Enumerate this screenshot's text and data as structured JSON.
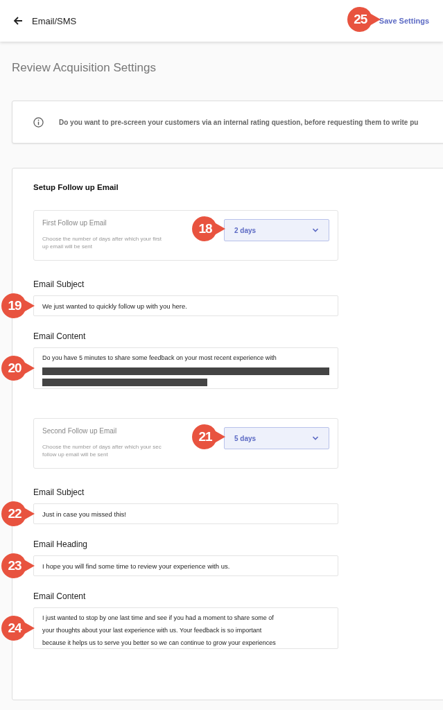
{
  "header": {
    "title": "Email/SMS",
    "save": {
      "label": "Save Settings",
      "callout": "25"
    }
  },
  "page_title": "Review Acquisition Settings",
  "info": {
    "text": "Do you want to pre-screen your customers via an internal rating question, before requesting them to write pu"
  },
  "card": {
    "title": "Setup Follow up Email",
    "items": [
      {
        "kind": "delay",
        "label": "First Follow up Email",
        "description_lines": [
          "Choose the number of days after which your first",
          "up email will be sent"
        ],
        "value": "2 days",
        "callout": "18"
      },
      {
        "kind": "field",
        "label": "Email Subject",
        "value": "We just wanted to quickly follow up with you here.",
        "callout": "19"
      },
      {
        "kind": "textarea",
        "label": "Email Content",
        "lines": [
          "Do you have 5 minutes to share some feedback on your most recent experience with"
        ],
        "redacted": true,
        "callout": "20"
      },
      {
        "kind": "delay",
        "label": "Second Follow up Email",
        "description_lines": [
          "Choose the number of days after which your sec",
          "follow up email will be sent"
        ],
        "value": "5 days",
        "callout": "21"
      },
      {
        "kind": "field",
        "label": "Email Subject",
        "value": "Just in case you missed this!",
        "callout": "22"
      },
      {
        "kind": "field",
        "label": "Email Heading",
        "value": "I hope you will find some time to review your experience with us.",
        "callout": "23"
      },
      {
        "kind": "textarea",
        "label": "Email Content",
        "lines": [
          " I just wanted to stop by one last time and see if you had a moment to share some of",
          "your thoughts about your last experience with us. Your feedback is so important",
          "because it helps us to serve you better so we can continue to grow your experiences"
        ],
        "callout": "24"
      }
    ]
  }
}
